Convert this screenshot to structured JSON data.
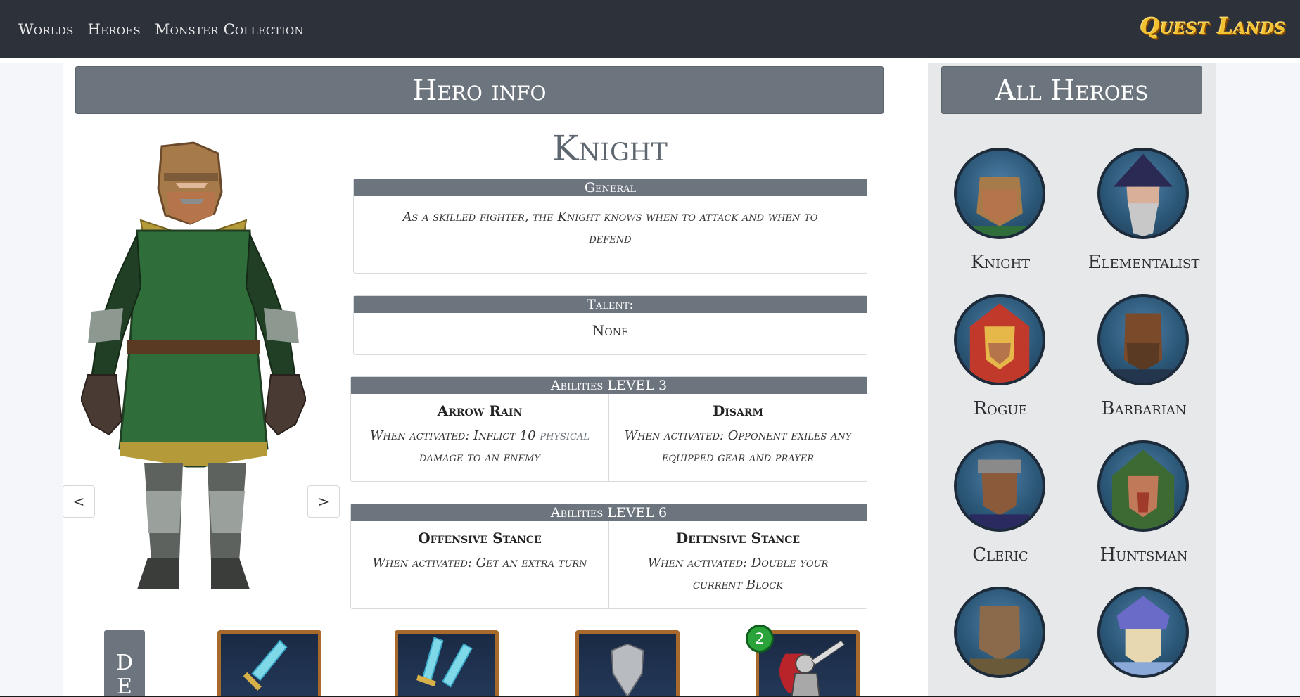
{
  "nav": {
    "links": [
      "Worlds",
      "Heroes",
      "Monster Collection"
    ],
    "logo": "Quest Lands"
  },
  "hero_info": {
    "title": "Hero info",
    "name": "Knight",
    "general_label": "General",
    "general_text": "As a skilled fighter, the Knight knows when to attack and when to defend",
    "talent_label": "Talent:",
    "talent_value": "None",
    "prev_label": "<",
    "next_label": ">"
  },
  "abilities": [
    {
      "header": "Abilities LEVEL 3",
      "items": [
        {
          "name": "Arrow Rain",
          "desc_pre": "When activated: Inflict 10",
          "damage_type": "physical",
          "desc_post": "damage to an enemy"
        },
        {
          "name": "Disarm",
          "desc_pre": "When activated: Opponent exiles any equipped gear and prayer",
          "damage_type": "",
          "desc_post": ""
        }
      ]
    },
    {
      "header": "Abilities LEVEL 6",
      "items": [
        {
          "name": "Offensive Stance",
          "desc_pre": "When activated: Get an extra turn",
          "damage_type": "",
          "desc_post": ""
        },
        {
          "name": "Defensive Stance",
          "desc_pre": "When activated: Double your current Block",
          "damage_type": "",
          "desc_post": ""
        }
      ]
    }
  ],
  "all_heroes": {
    "title": "All Heroes",
    "heroes": [
      "Knight",
      "Elementalist",
      "Rogue",
      "Barbarian",
      "Cleric",
      "Huntsman"
    ]
  },
  "deck": {
    "tab_letters": [
      "D",
      "E"
    ],
    "badge_count": "2",
    "cards": [
      "sword-icon",
      "dual-swords-icon",
      "shield-icon",
      "knight-attack-icon"
    ]
  },
  "colors": {
    "navbar": "#2d323a",
    "header_gray": "#6c757d",
    "logo_gold": "#f1c232",
    "badge_green": "#2aa33a"
  }
}
